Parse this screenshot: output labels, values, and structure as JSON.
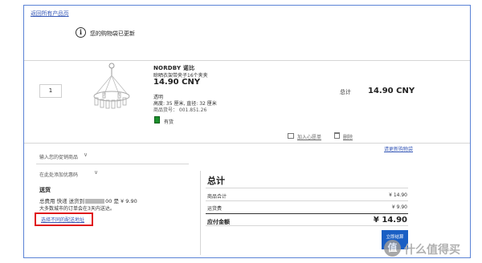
{
  "page": {
    "back_link": "返回所有产品页",
    "notice_icon_glyph": "i",
    "notice": "您的购物袋已更新"
  },
  "cart_item": {
    "quantity": "1",
    "name": "NORDBY 诺比",
    "description": "晾晒衣架带夹子16个夹夹",
    "price": "14.90 CNY",
    "color": "透明",
    "dimensions": "高度: 35 厘米, 直径: 32 厘米",
    "article_no": "商品货号： 001.851.26",
    "stock_status": "有货",
    "total_label": "总计",
    "total_price": "14.90 CNY",
    "add_to_list": "加入心愿单",
    "delete": "删除"
  },
  "cart_actions": {
    "update_link": "请更新购物袋"
  },
  "promo": {
    "enter_code_label": "输入您的促销商品",
    "coupon_label": "在此处添加优惠码",
    "chevron": "∨"
  },
  "shipping": {
    "title": "送货",
    "line1_prefix": "总费用 快递 送货到",
    "line1_suffix": "00 是 ¥ 9.90",
    "line2": "大多数城市的订单会在3天内送达。",
    "change_link": "选择不同的配送地址"
  },
  "summary": {
    "title": "总计",
    "rows": [
      {
        "label": "商品合计",
        "value": "¥ 14.90"
      },
      {
        "label": "运货费",
        "value": "¥ 9.90"
      }
    ],
    "total_label": "应付金额",
    "total_value": "¥ 14.90",
    "checkout_label": "立即结算"
  },
  "watermark": {
    "badge": "值",
    "text": "什么值得买"
  },
  "colors": {
    "frame": "#5b83d6",
    "link": "#3a5bb8",
    "highlight": "#e0141b",
    "stock": "#1b8f2c",
    "button": "#1a5fc4"
  }
}
